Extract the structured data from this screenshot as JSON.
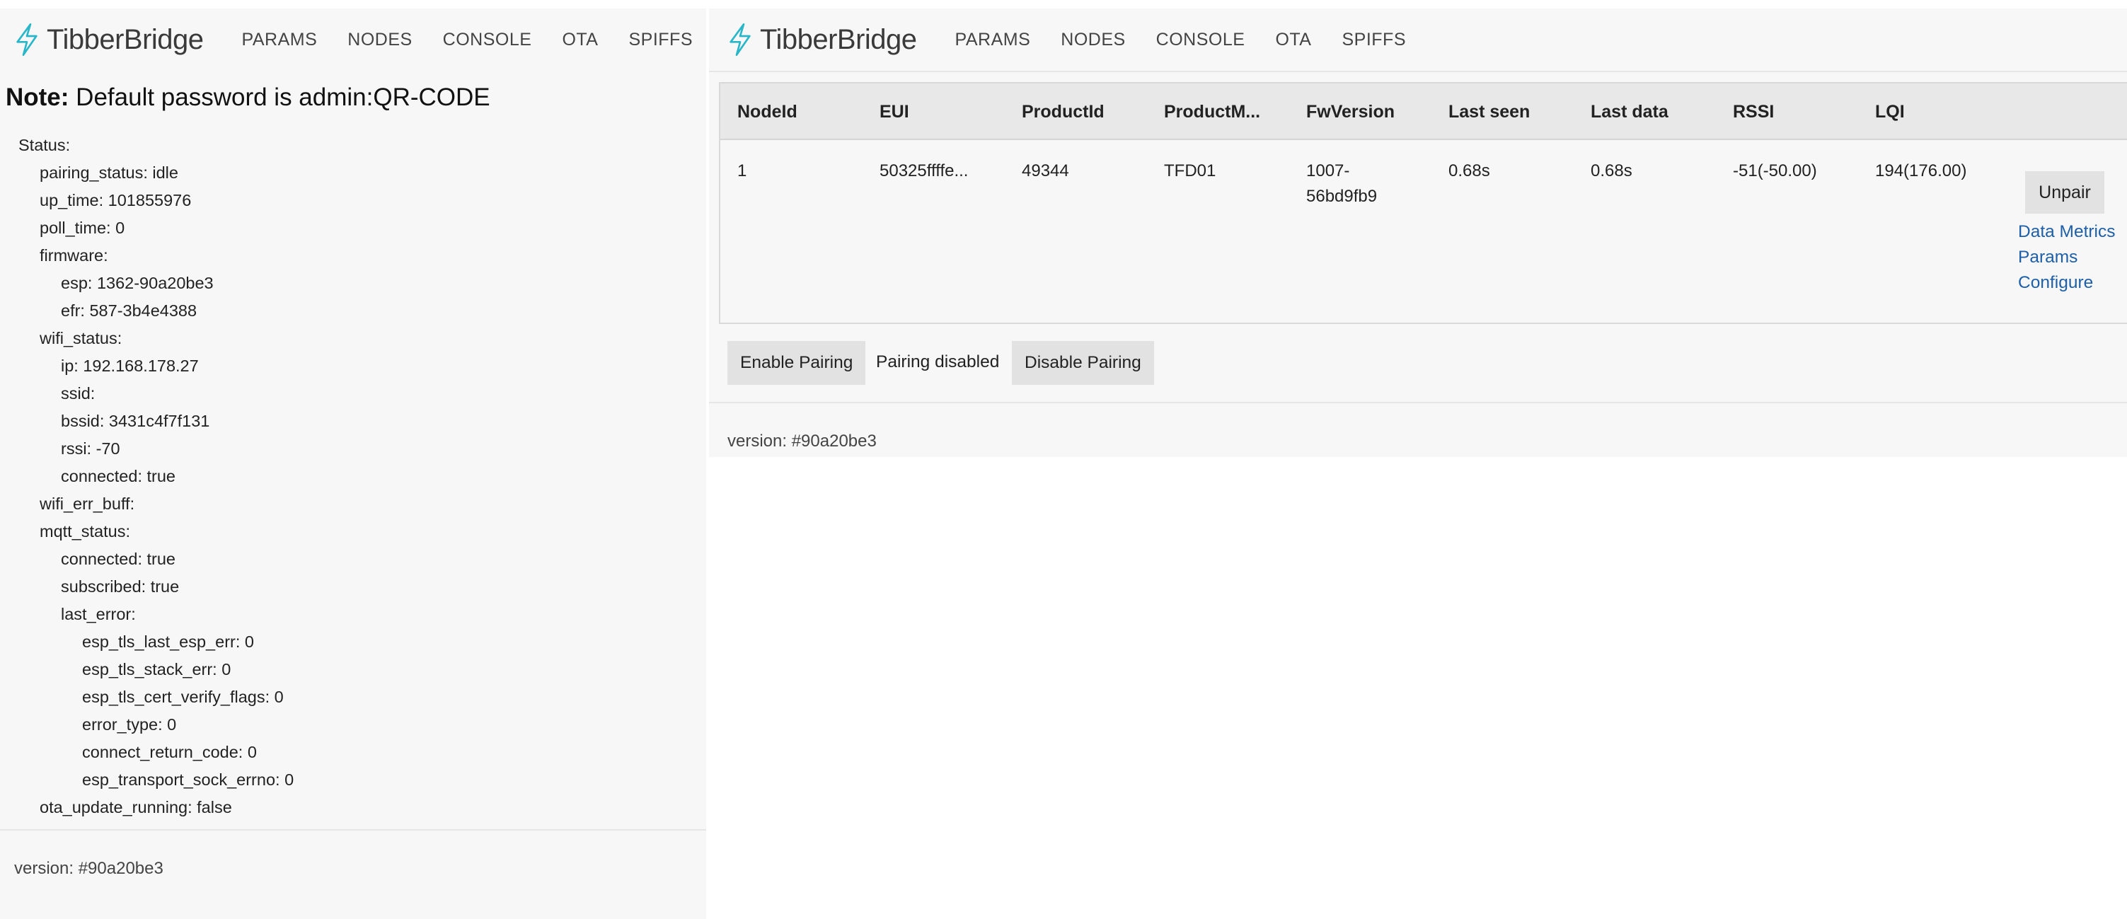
{
  "brand": {
    "name": "TibberBridge",
    "accent_color": "#29b6c9",
    "icon": "lightning-bolt-icon"
  },
  "nav": [
    "PARAMS",
    "NODES",
    "CONSOLE",
    "OTA",
    "SPIFFS"
  ],
  "left": {
    "note_label": "Note:",
    "note_text": "Default password is admin:QR-CODE",
    "status_tree": [
      {
        "depth": 0,
        "text": "Status:"
      },
      {
        "depth": 1,
        "text": "pairing_status: idle"
      },
      {
        "depth": 1,
        "text": "up_time: 101855976"
      },
      {
        "depth": 1,
        "text": "poll_time: 0"
      },
      {
        "depth": 1,
        "text": "firmware:"
      },
      {
        "depth": 2,
        "text": "esp: 1362-90a20be3"
      },
      {
        "depth": 2,
        "text": "efr: 587-3b4e4388"
      },
      {
        "depth": 1,
        "text": "wifi_status:"
      },
      {
        "depth": 2,
        "text": "ip: 192.168.178.27"
      },
      {
        "depth": 2,
        "text": "ssid:"
      },
      {
        "depth": 2,
        "text": "bssid: 3431c4f7f131"
      },
      {
        "depth": 2,
        "text": "rssi: -70"
      },
      {
        "depth": 2,
        "text": "connected: true"
      },
      {
        "depth": 1,
        "text": "wifi_err_buff:"
      },
      {
        "depth": 1,
        "text": "mqtt_status:"
      },
      {
        "depth": 2,
        "text": "connected: true"
      },
      {
        "depth": 2,
        "text": "subscribed: true"
      },
      {
        "depth": 2,
        "text": "last_error:"
      },
      {
        "depth": 3,
        "text": "esp_tls_last_esp_err: 0"
      },
      {
        "depth": 3,
        "text": "esp_tls_stack_err: 0"
      },
      {
        "depth": 3,
        "text": "esp_tls_cert_verify_flags: 0"
      },
      {
        "depth": 3,
        "text": "error_type: 0"
      },
      {
        "depth": 3,
        "text": "connect_return_code: 0"
      },
      {
        "depth": 3,
        "text": "esp_transport_sock_errno: 0"
      },
      {
        "depth": 1,
        "text": "ota_update_running: false"
      }
    ],
    "version": "version: #90a20be3"
  },
  "right": {
    "table": {
      "columns": [
        "NodeId",
        "EUI",
        "ProductId",
        "ProductM...",
        "FwVersion",
        "Last seen",
        "Last data",
        "RSSI",
        "LQI"
      ],
      "rows": [
        {
          "NodeId": "1",
          "EUI": "50325ffffe...",
          "ProductId": "49344",
          "ProductModel": "TFD01",
          "FwVersion_line1": "1007-",
          "FwVersion_line2": "56bd9fb9",
          "LastSeen": "0.68s",
          "LastData": "0.68s",
          "RSSI": "-51(-50.00)",
          "LQI": "194(176.00)"
        }
      ],
      "row_actions": {
        "unpair": "Unpair",
        "links": [
          "Data Metrics",
          "Params",
          "Configure"
        ]
      }
    },
    "pairing": {
      "enable_label": "Enable Pairing",
      "status_text": "Pairing disabled",
      "disable_label": "Disable Pairing"
    },
    "version": "version: #90a20be3"
  }
}
